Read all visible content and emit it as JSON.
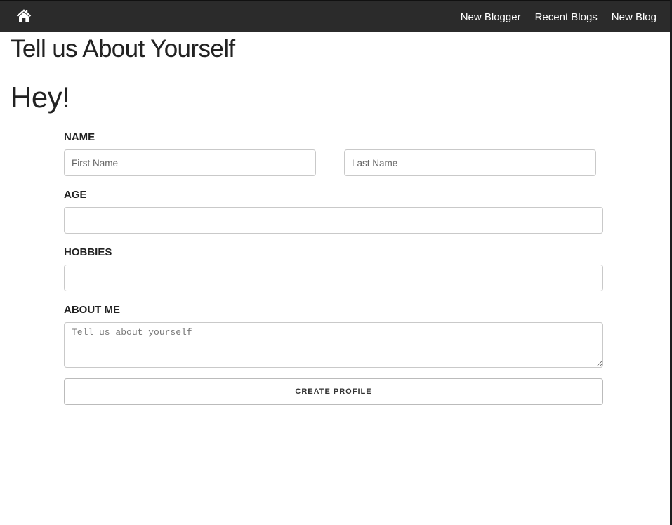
{
  "navbar": {
    "home_icon": "home-icon",
    "links": [
      "New Blogger",
      "Recent Blogs",
      "New Blog"
    ]
  },
  "page": {
    "title": "Tell us About Yourself",
    "greeting": "Hey!"
  },
  "form": {
    "name": {
      "label": "NAME",
      "first_placeholder": "First Name",
      "first_value": "",
      "last_placeholder": "Last Name",
      "last_value": ""
    },
    "age": {
      "label": "AGE",
      "value": ""
    },
    "hobbies": {
      "label": "HOBBIES",
      "value": ""
    },
    "about": {
      "label": "ABOUT ME",
      "placeholder": "Tell us about yourself",
      "value": ""
    },
    "submit_label": "CREATE PROFILE"
  },
  "colors": {
    "navbar_bg": "#2b2b2b",
    "nav_text": "#ffffff",
    "text": "#222222",
    "input_border": "#c9c9c9"
  }
}
